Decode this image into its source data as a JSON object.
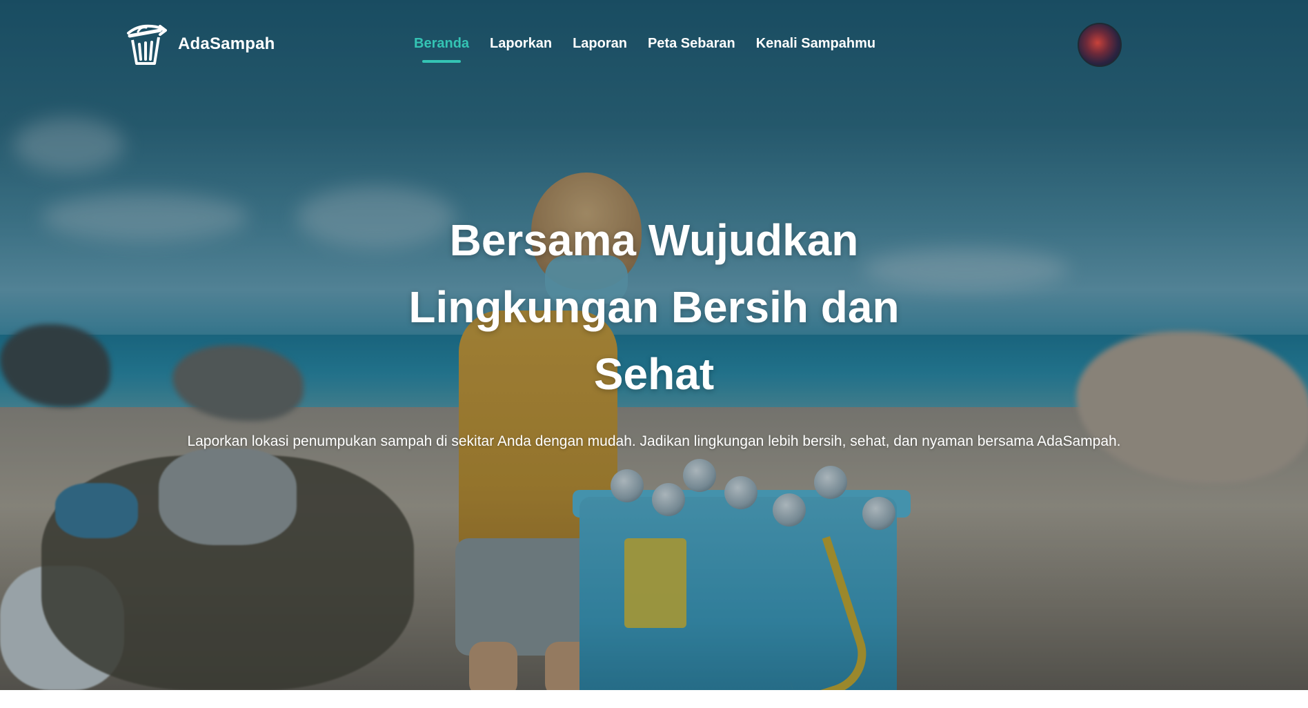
{
  "brand": {
    "name": "AdaSampah",
    "logo_icon": "trash-bin-recycle-icon"
  },
  "nav": {
    "items": [
      {
        "label": "Beranda",
        "active": true
      },
      {
        "label": "Laporkan",
        "active": false
      },
      {
        "label": "Laporan",
        "active": false
      },
      {
        "label": "Peta Sebaran",
        "active": false
      },
      {
        "label": "Kenali Sampahmu",
        "active": false
      }
    ]
  },
  "user": {
    "avatar_icon": "user-avatar-icon"
  },
  "hero": {
    "title_line1": "Bersama Wujudkan",
    "title_line2": "Lingkungan Bersih dan",
    "title_line3": "Sehat",
    "subtitle": "Laporkan lokasi penumpukan sampah di sekitar Anda dengan mudah. Jadikan lingkungan lebih bersih, sehat, dan nyaman bersama AdaSampah."
  },
  "colors": {
    "accent": "#34c4b4",
    "text": "#ffffff"
  }
}
